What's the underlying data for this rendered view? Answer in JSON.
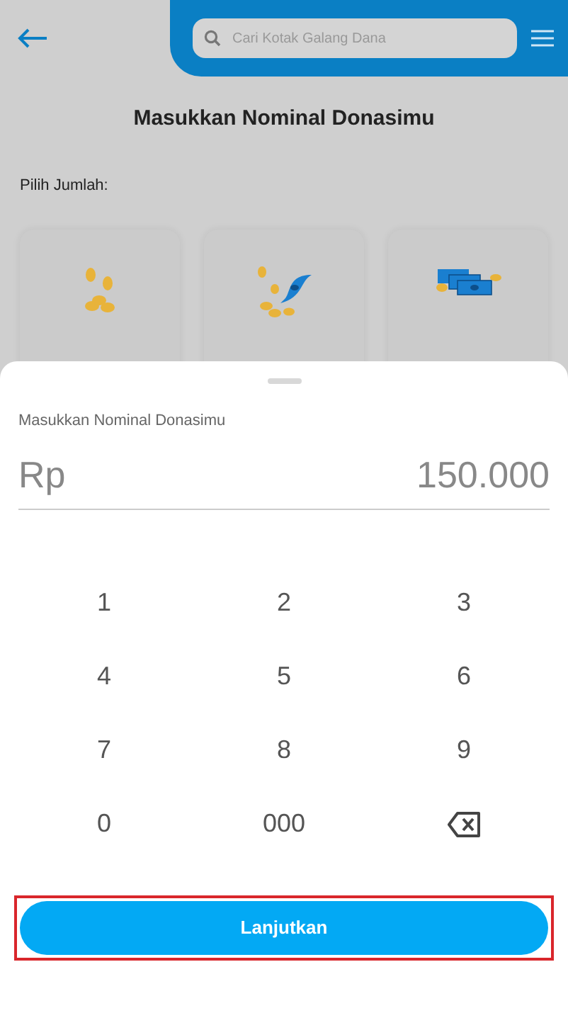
{
  "header": {
    "search": {
      "placeholder": "Cari Kotak Galang Dana"
    }
  },
  "page": {
    "title": "Masukkan Nominal Donasimu",
    "amount_label": "Pilih Jumlah:",
    "cards": [
      {
        "kind": "coins"
      },
      {
        "kind": "bill"
      },
      {
        "kind": "stack"
      }
    ]
  },
  "sheet": {
    "label": "Masukkan Nominal Donasimu",
    "currency": "Rp",
    "value": "150.000",
    "keys": [
      {
        "kind": "digit",
        "label": "1"
      },
      {
        "kind": "digit",
        "label": "2"
      },
      {
        "kind": "digit",
        "label": "3"
      },
      {
        "kind": "digit",
        "label": "4"
      },
      {
        "kind": "digit",
        "label": "5"
      },
      {
        "kind": "digit",
        "label": "6"
      },
      {
        "kind": "digit",
        "label": "7"
      },
      {
        "kind": "digit",
        "label": "8"
      },
      {
        "kind": "digit",
        "label": "9"
      },
      {
        "kind": "digit",
        "label": "0"
      },
      {
        "kind": "digit",
        "label": "000"
      },
      {
        "kind": "backspace"
      }
    ],
    "button": "Lanjutkan"
  }
}
